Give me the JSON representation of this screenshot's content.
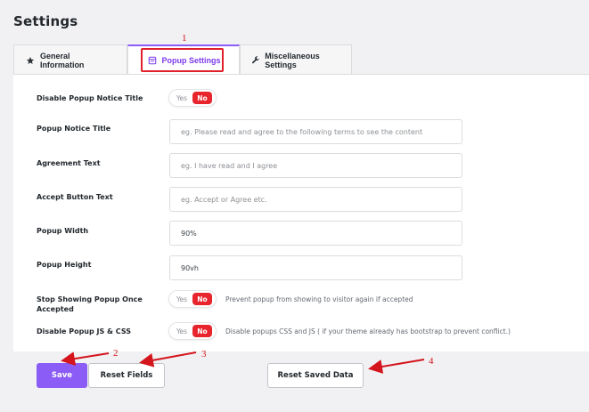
{
  "page": {
    "title": "Settings"
  },
  "tabs": [
    {
      "label": "General Information",
      "icon": "star-icon",
      "active": false
    },
    {
      "label": "Popup Settings",
      "icon": "popup-window-icon",
      "active": true
    },
    {
      "label": "Miscellaneous Settings",
      "icon": "wrench-icon",
      "active": false
    }
  ],
  "fields": {
    "disable_title": {
      "label": "Disable Popup Notice Title",
      "yes": "Yes",
      "no": "No",
      "value": "No"
    },
    "notice_title": {
      "label": "Popup Notice Title",
      "value": "",
      "placeholder": "eg. Please read and agree to the following terms to see the content"
    },
    "agreement_text": {
      "label": "Agreement Text",
      "value": "",
      "placeholder": "eg. I have read and I agree"
    },
    "accept_button": {
      "label": "Accept Button Text",
      "value": "",
      "placeholder": "eg. Accept or Agree etc."
    },
    "popup_width": {
      "label": "Popup Width",
      "value": "90%"
    },
    "popup_height": {
      "label": "Popup Height",
      "value": "90vh"
    },
    "stop_showing": {
      "label": "Stop Showing Popup Once Accepted",
      "yes": "Yes",
      "no": "No",
      "value": "No",
      "hint": "Prevent popup from showing to visitor again if accepted"
    },
    "disable_js_css": {
      "label": "Disable Popup JS & CSS",
      "yes": "Yes",
      "no": "No",
      "value": "No",
      "hint": "Disable popups CSS and JS ( if your theme already has bootstrap to prevent conflict.)"
    }
  },
  "buttons": {
    "save": "Save",
    "reset_fields": "Reset Fields",
    "reset_saved_data": "Reset Saved Data"
  },
  "annotations": {
    "n1": "1",
    "n2": "2",
    "n3": "3",
    "n4": "4"
  },
  "colors": {
    "accent": "#8b5cf6",
    "toggle_no": "#e8252d",
    "annotation": "#d4151d"
  }
}
